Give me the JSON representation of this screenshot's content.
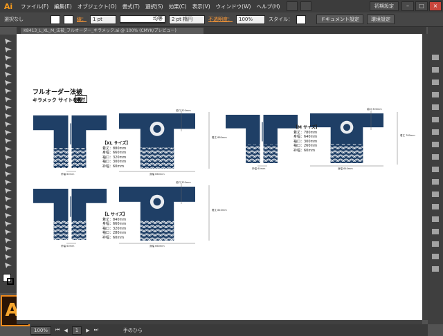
{
  "app": {
    "logo": "Ai"
  },
  "menu": [
    {
      "label": "ファイル(F)"
    },
    {
      "label": "編集(E)"
    },
    {
      "label": "オブジェクト(O)"
    },
    {
      "label": "書式(T)"
    },
    {
      "label": "選択(S)"
    },
    {
      "label": "効果(C)"
    },
    {
      "label": "表示(V)"
    },
    {
      "label": "ウィンドウ(W)"
    },
    {
      "label": "ヘルプ(H)"
    }
  ],
  "workspace": "初期設定",
  "controlbar": {
    "selection": "選択なし",
    "stroke_label": "線：",
    "stroke_value": "1 pt",
    "profile_label": "均等",
    "brush_value": "2 pt 楕円",
    "opacity_label": "不透明度：",
    "opacity_value": "100%",
    "style_label": "スタイル：",
    "doc_settings": "ドキュメント設定",
    "preferences": "環境設定"
  },
  "tab": {
    "title": "K8413_L_XL_M_法被_フルオーダー_キラメック.ai @ 100% (CMYK/プレビュー)"
  },
  "status": {
    "zoom": "100%",
    "page": "1",
    "tool": "手のひら"
  },
  "artwork": {
    "title": "フルオーダー法被",
    "subtitle": "キラメック サイト参照",
    "tag": "裏付",
    "garment_color": "#1f3f66",
    "specs": [
      {
        "size": "【XL サイズ】",
        "lines": [
          "着丈：880mm",
          "身幅：660mm",
          "袖口：320mm",
          "袖口：300mm",
          "衿幅：60mm"
        ]
      },
      {
        "size": "【L サイズ】",
        "lines": [
          "着丈：840mm",
          "身幅：660mm",
          "袖口：320mm",
          "袖口：280mm",
          "衿幅：60mm"
        ]
      },
      {
        "size": "【M サイズ】",
        "lines": [
          "着丈：780mm",
          "身幅：640mm",
          "袖口：300mm",
          "袖口：260mm",
          "衿幅：60mm"
        ]
      }
    ],
    "dims": {
      "xl": {
        "width": "身幅 660mm",
        "height": "着丈 880mm",
        "sleeve": "袖口 320mm",
        "front": "衿幅 60mm"
      },
      "l": {
        "width": "身幅 660mm",
        "height": "着丈 840mm",
        "sleeve": "袖口 320mm",
        "front": "衿幅 60mm"
      },
      "m": {
        "width": "身幅 640mm",
        "height": "着丈 780mm",
        "sleeve": "袖口 300mm",
        "front": "衿幅 60mm"
      }
    }
  }
}
